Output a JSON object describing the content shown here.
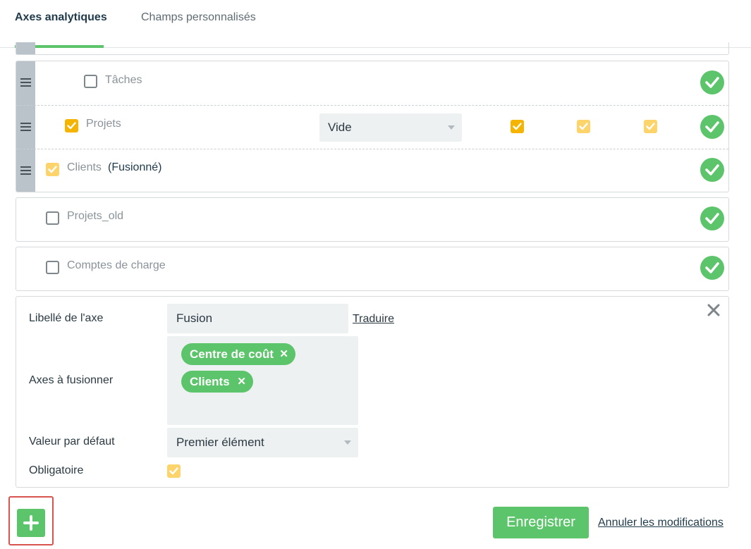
{
  "tabs": [
    {
      "label": "Axes analytiques",
      "active": true
    },
    {
      "label": "Champs personnalisés",
      "active": false
    }
  ],
  "group": {
    "rows": [
      {
        "label": "Tâches",
        "checked": false
      },
      {
        "label": "Projets",
        "checked": true,
        "select_value": "Vide"
      },
      {
        "label": "Clients",
        "suffix": "(Fusionné)",
        "checked": true
      }
    ]
  },
  "cards": [
    {
      "label": "Projets_old",
      "checked": false
    },
    {
      "label": "Comptes de charge",
      "checked": false
    }
  ],
  "editor": {
    "label_field_label": "Libellé de l'axe",
    "label_field_value": "Fusion",
    "translate_link": "Traduire",
    "merge_label": "Axes à fusionner",
    "merge_tags": [
      "Centre de coût",
      "Clients"
    ],
    "default_label": "Valeur par défaut",
    "default_value": "Premier élément",
    "required_label": "Obligatoire",
    "required_checked": true
  },
  "footer": {
    "save_label": "Enregistrer",
    "cancel_label": "Annuler les modifications"
  },
  "colors": {
    "accent_green": "#5cc46a",
    "checkbox_orange": "#f5b400",
    "checkbox_yellow": "#fcd46b",
    "grip_gray": "#b9c3c9"
  },
  "icons": [
    "drag-handle-icon",
    "check-circle-icon",
    "checkbox-icon",
    "chevron-down-icon",
    "close-icon",
    "plus-icon"
  ]
}
